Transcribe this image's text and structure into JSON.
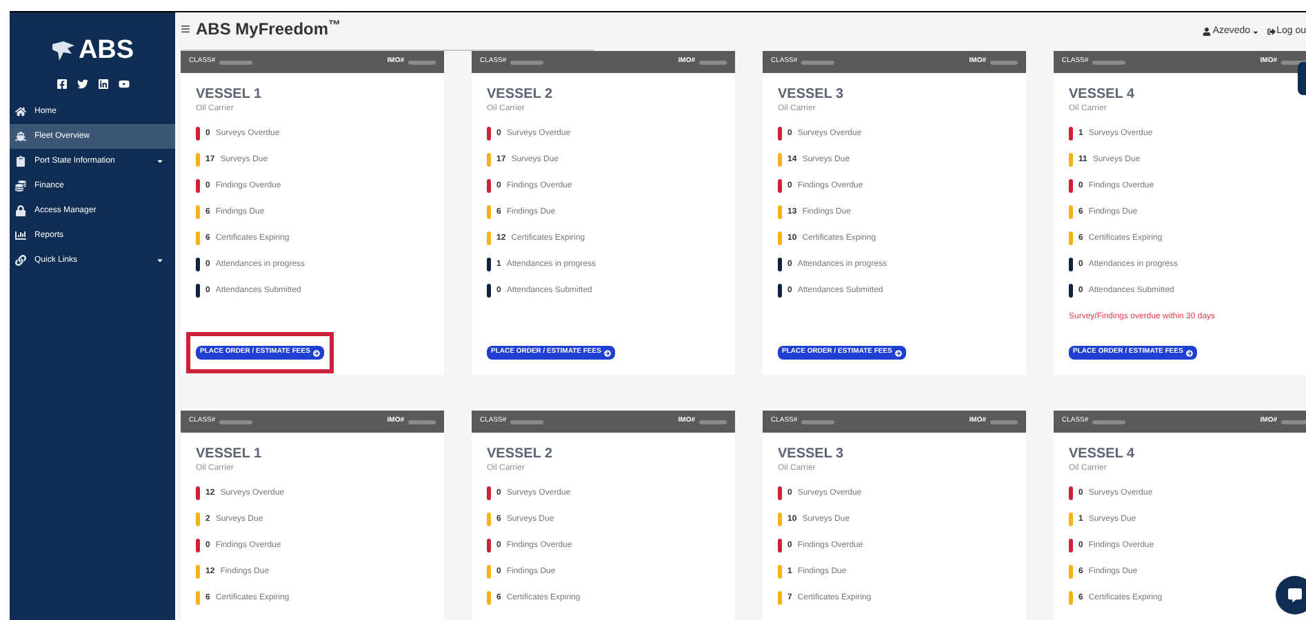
{
  "sidebar": {
    "logo": "ABS",
    "items": [
      {
        "label": "Home",
        "selected": false,
        "has_submenu": false
      },
      {
        "label": "Fleet Overview",
        "selected": true,
        "has_submenu": false
      },
      {
        "label": "Port State Information",
        "selected": false,
        "has_submenu": true
      },
      {
        "label": "Finance",
        "selected": false,
        "has_submenu": false
      },
      {
        "label": "Access Manager",
        "selected": false,
        "has_submenu": false
      },
      {
        "label": "Reports",
        "selected": false,
        "has_submenu": false
      },
      {
        "label": "Quick Links",
        "selected": false,
        "has_submenu": true
      }
    ]
  },
  "header": {
    "menu_glyph": "≡",
    "title": "ABS MyFreedom",
    "title_mark": "™",
    "user": "Azevedo",
    "logout": "Log ou"
  },
  "vessels": [
    {
      "class_label": "CLASS#",
      "imo_label": "IMO#",
      "name": "VESSEL 1",
      "type": "Oil Carrier",
      "button": {
        "label": "PLACE ORDER / ESTIMATE FEES",
        "highlighted": true
      },
      "stats": [
        {
          "count": "0",
          "label": "Surveys Overdue",
          "color": "#d0213a"
        },
        {
          "count": "17",
          "label": "Surveys Due",
          "color": "#f5b21a"
        },
        {
          "count": "0",
          "label": "Findings Overdue",
          "color": "#d0213a"
        },
        {
          "count": "6",
          "label": "Findings Due",
          "color": "#f5b21a"
        },
        {
          "count": "6",
          "label": "Certificates Expiring",
          "color": "#f5b21a"
        },
        {
          "count": "0",
          "label": "Attendances in progress",
          "color": "#0d2340"
        },
        {
          "count": "0",
          "label": "Attendances Submitted",
          "color": "#0d2340"
        }
      ]
    },
    {
      "class_label": "CLASS#",
      "imo_label": "IMO#",
      "name": "VESSEL 2",
      "type": "Oil Carrier",
      "button": {
        "label": "PLACE ORDER / ESTIMATE FEES",
        "highlighted": false
      },
      "stats": [
        {
          "count": "0",
          "label": "Surveys Overdue",
          "color": "#d0213a"
        },
        {
          "count": "17",
          "label": "Surveys Due",
          "color": "#f5b21a"
        },
        {
          "count": "0",
          "label": "Findings Overdue",
          "color": "#d0213a"
        },
        {
          "count": "6",
          "label": "Findings Due",
          "color": "#f5b21a"
        },
        {
          "count": "12",
          "label": "Certificates Expiring",
          "color": "#f5b21a"
        },
        {
          "count": "1",
          "label": "Attendances in progress",
          "color": "#0d2340"
        },
        {
          "count": "0",
          "label": "Attendances Submitted",
          "color": "#0d2340"
        }
      ]
    },
    {
      "class_label": "CLASS#",
      "imo_label": "IMO#",
      "name": "VESSEL 3",
      "type": "Oil Carrier",
      "button": {
        "label": "PLACE ORDER / ESTIMATE FEES",
        "highlighted": false
      },
      "stats": [
        {
          "count": "0",
          "label": "Surveys Overdue",
          "color": "#d0213a"
        },
        {
          "count": "14",
          "label": "Surveys Due",
          "color": "#f5b21a"
        },
        {
          "count": "0",
          "label": "Findings Overdue",
          "color": "#d0213a"
        },
        {
          "count": "13",
          "label": "Findings Due",
          "color": "#f5b21a"
        },
        {
          "count": "10",
          "label": "Certificates Expiring",
          "color": "#f5b21a"
        },
        {
          "count": "0",
          "label": "Attendances in progress",
          "color": "#0d2340"
        },
        {
          "count": "0",
          "label": "Attendances Submitted",
          "color": "#0d2340"
        }
      ]
    },
    {
      "class_label": "CLASS#",
      "imo_label": "IMO#",
      "name": "VESSEL 4",
      "type": "Oil Carrier",
      "warning": "Survey/Findings overdue within 30 days",
      "button": {
        "label": "PLACE ORDER / ESTIMATE FEES",
        "highlighted": false
      },
      "stats": [
        {
          "count": "1",
          "label": "Surveys Overdue",
          "color": "#d0213a"
        },
        {
          "count": "11",
          "label": "Surveys Due",
          "color": "#f5b21a"
        },
        {
          "count": "0",
          "label": "Findings Overdue",
          "color": "#d0213a"
        },
        {
          "count": "6",
          "label": "Findings Due",
          "color": "#f5b21a"
        },
        {
          "count": "6",
          "label": "Certificates Expiring",
          "color": "#f5b21a"
        },
        {
          "count": "0",
          "label": "Attendances in progress",
          "color": "#0d2340"
        },
        {
          "count": "0",
          "label": "Attendances Submitted",
          "color": "#0d2340"
        }
      ]
    },
    {
      "class_label": "CLASS#",
      "imo_label": "IMO#",
      "name": "VESSEL 1",
      "type": "Oil Carrier",
      "stats": [
        {
          "count": "12",
          "label": "Surveys Overdue",
          "color": "#d0213a"
        },
        {
          "count": "2",
          "label": "Surveys Due",
          "color": "#f5b21a"
        },
        {
          "count": "0",
          "label": "Findings Overdue",
          "color": "#d0213a"
        },
        {
          "count": "12",
          "label": "Findings Due",
          "color": "#f5b21a"
        },
        {
          "count": "6",
          "label": "Certificates Expiring",
          "color": "#f5b21a"
        }
      ]
    },
    {
      "class_label": "CLASS#",
      "imo_label": "IMO#",
      "name": "VESSEL 2",
      "type": "Oil Carrier",
      "stats": [
        {
          "count": "0",
          "label": "Surveys Overdue",
          "color": "#d0213a"
        },
        {
          "count": "6",
          "label": "Surveys Due",
          "color": "#f5b21a"
        },
        {
          "count": "0",
          "label": "Findings Overdue",
          "color": "#d0213a"
        },
        {
          "count": "0",
          "label": "Findings Due",
          "color": "#f5b21a"
        },
        {
          "count": "6",
          "label": "Certificates Expiring",
          "color": "#f5b21a"
        }
      ]
    },
    {
      "class_label": "CLASS#",
      "imo_label": "IMO#",
      "name": "VESSEL 3",
      "type": "Oil Carrier",
      "stats": [
        {
          "count": "0",
          "label": "Surveys Overdue",
          "color": "#d0213a"
        },
        {
          "count": "10",
          "label": "Surveys Due",
          "color": "#f5b21a"
        },
        {
          "count": "0",
          "label": "Findings Overdue",
          "color": "#d0213a"
        },
        {
          "count": "1",
          "label": "Findings Due",
          "color": "#f5b21a"
        },
        {
          "count": "7",
          "label": "Certificates Expiring",
          "color": "#f5b21a"
        }
      ]
    },
    {
      "class_label": "CLASS#",
      "imo_label": "IMO#",
      "name": "VESSEL 4",
      "type": "Oil Carrier",
      "stats": [
        {
          "count": "0",
          "label": "Surveys Overdue",
          "color": "#d0213a"
        },
        {
          "count": "1",
          "label": "Surveys Due",
          "color": "#f5b21a"
        },
        {
          "count": "0",
          "label": "Findings Overdue",
          "color": "#d0213a"
        },
        {
          "count": "6",
          "label": "Findings Due",
          "color": "#f5b21a"
        },
        {
          "count": "6",
          "label": "Certificates Expiring",
          "color": "#f5b21a"
        }
      ]
    }
  ]
}
